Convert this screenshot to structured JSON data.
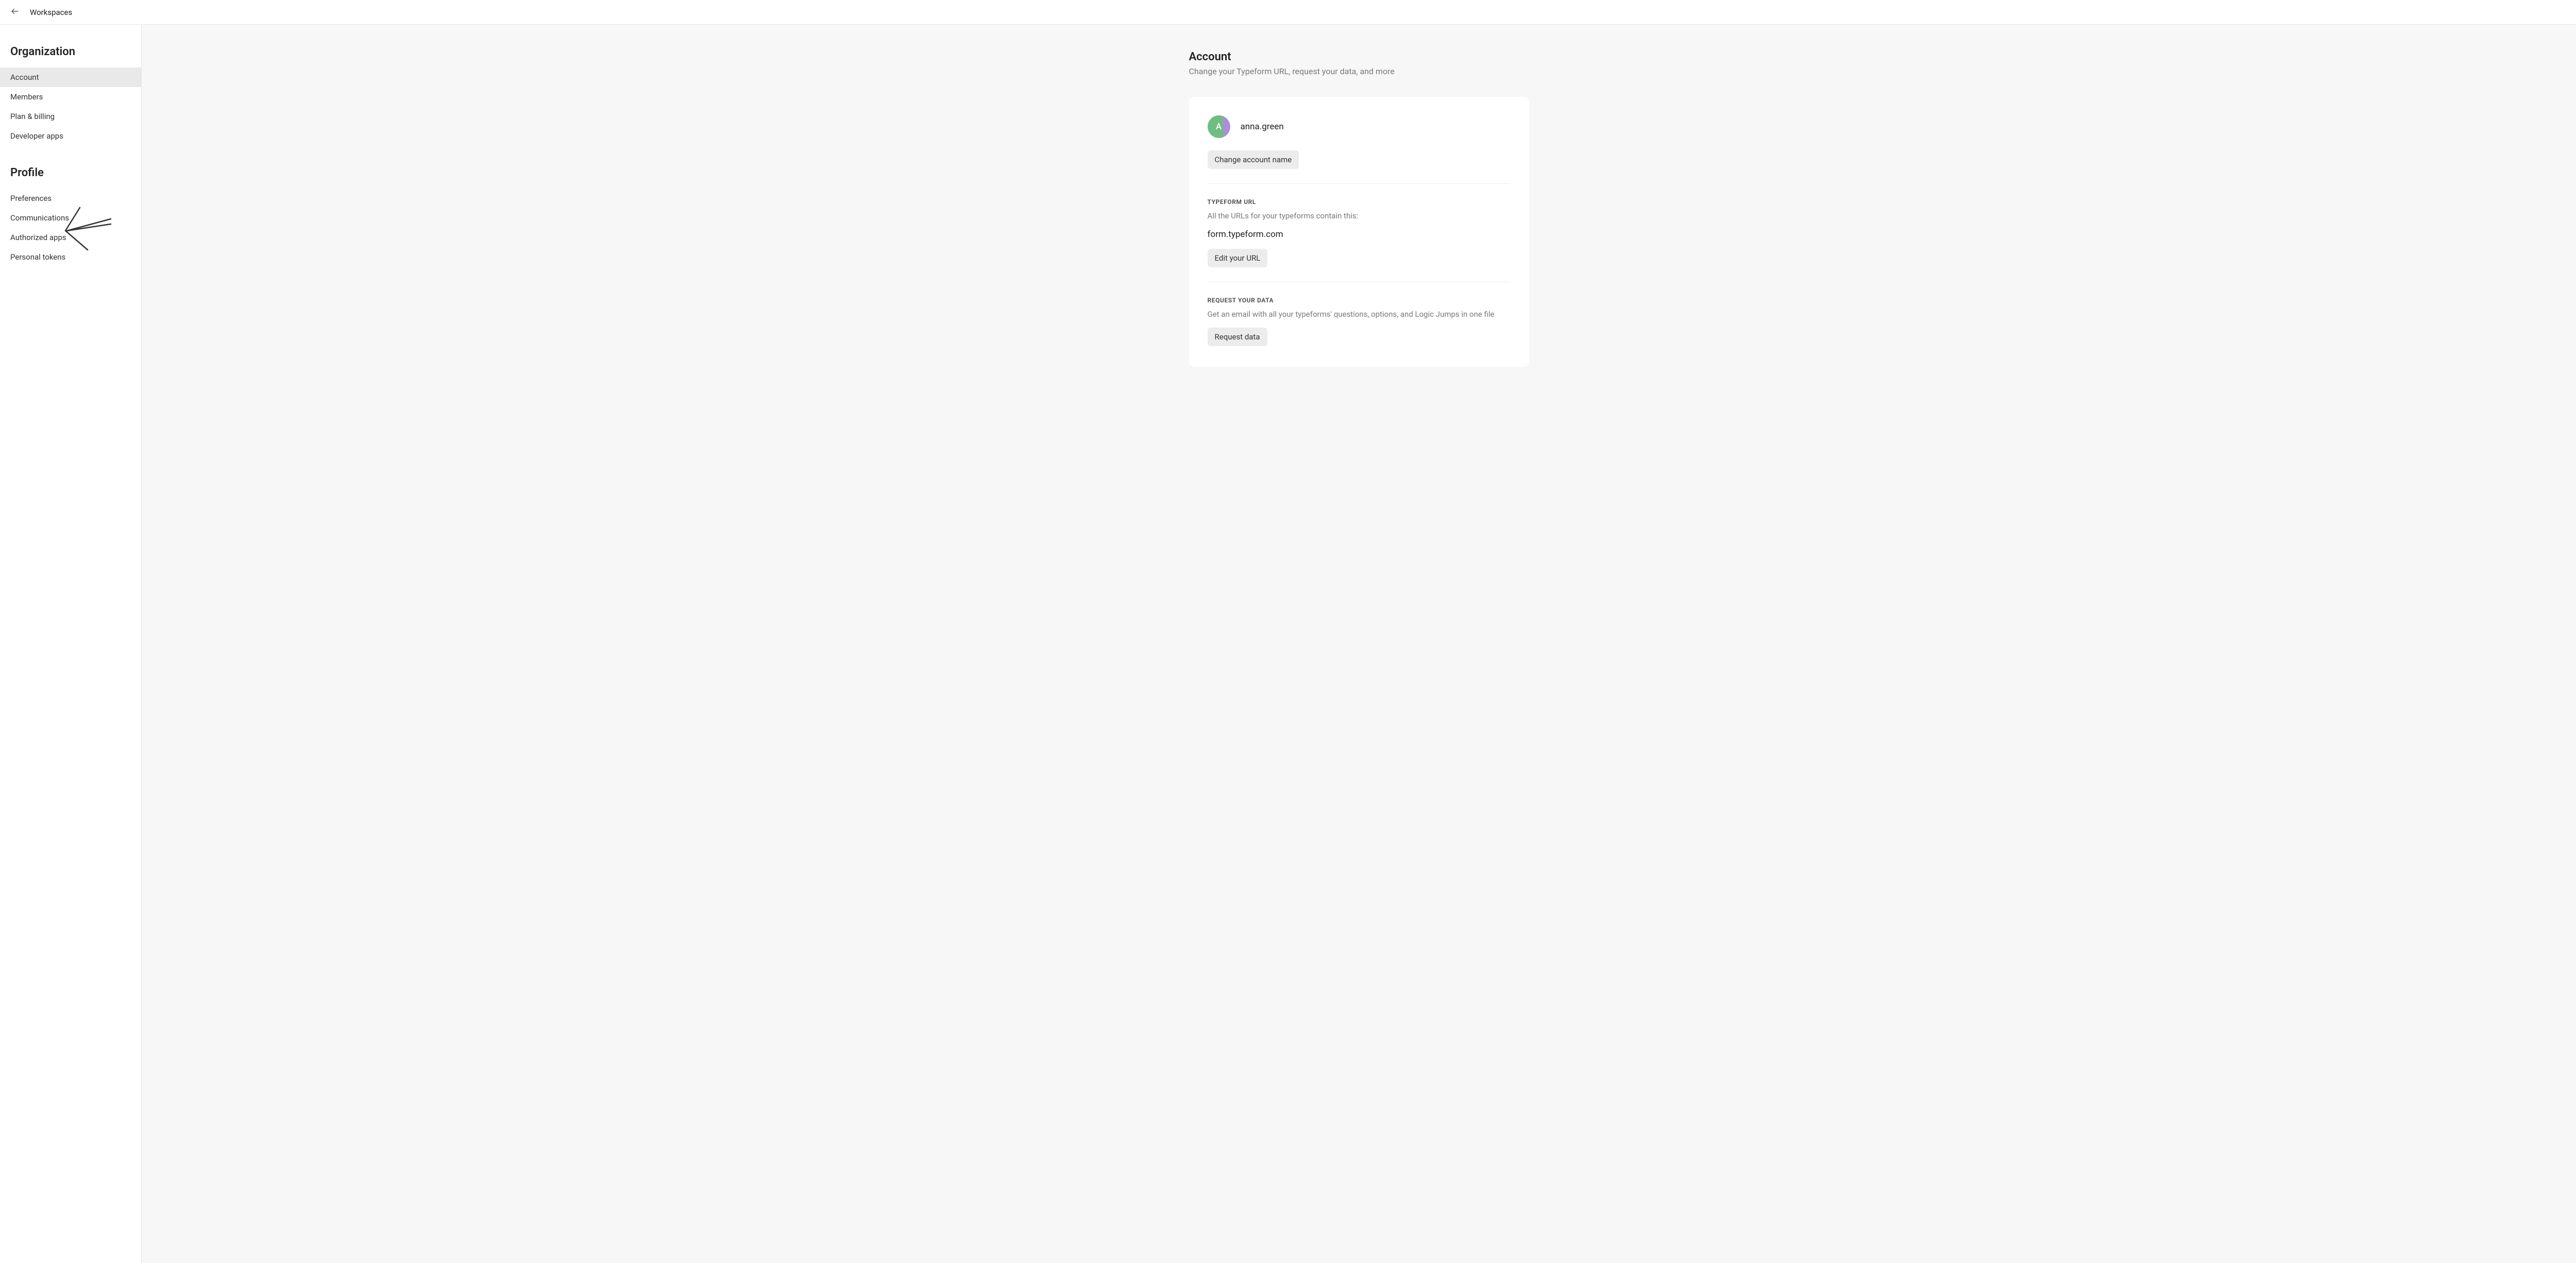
{
  "header": {
    "breadcrumb": "Workspaces"
  },
  "sidebar": {
    "group_org": "Organization",
    "group_profile": "Profile",
    "org_items": [
      {
        "label": "Account",
        "active": true
      },
      {
        "label": "Members",
        "active": false
      },
      {
        "label": "Plan & billing",
        "active": false
      },
      {
        "label": "Developer apps",
        "active": false
      }
    ],
    "profile_items": [
      {
        "label": "Preferences"
      },
      {
        "label": "Communications"
      },
      {
        "label": "Authorized apps"
      },
      {
        "label": "Personal tokens"
      }
    ]
  },
  "page": {
    "title": "Account",
    "subtitle": "Change your Typeform URL, request your data, and more"
  },
  "account": {
    "avatar_letter": "A",
    "avatar_colors": {
      "left": "#6fbd7f",
      "right": "#a88fd8"
    },
    "username": "anna.green",
    "change_name_btn": "Change account name"
  },
  "url_section": {
    "label": "TYPEFORM URL",
    "desc": "All the URLs for your typeforms contain this:",
    "value": "form.typeform.com",
    "edit_btn": "Edit your URL"
  },
  "data_section": {
    "label": "REQUEST YOUR DATA",
    "desc": "Get an email with all your typeforms' questions, options, and Logic Jumps in one file",
    "request_btn": "Request data"
  }
}
